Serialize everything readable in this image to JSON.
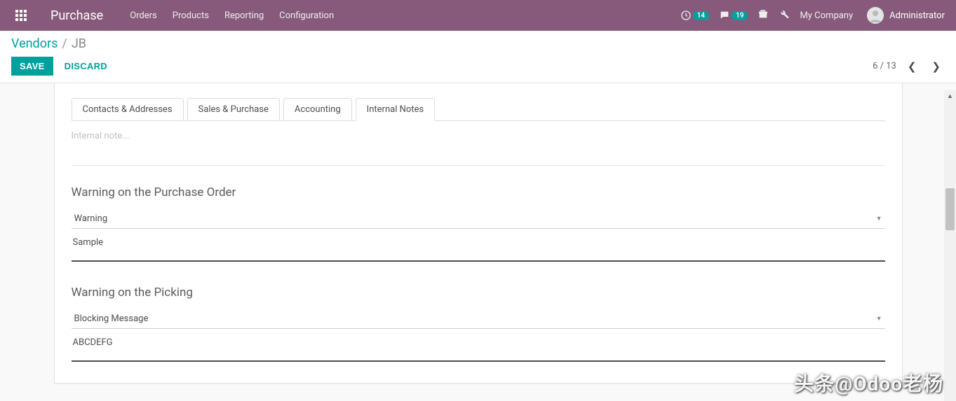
{
  "navbar": {
    "brand": "Purchase",
    "menu": [
      "Orders",
      "Products",
      "Reporting",
      "Configuration"
    ],
    "activity_count": "14",
    "message_count": "19",
    "company": "My Company",
    "user": "Administrator"
  },
  "breadcrumb": {
    "parent": "Vendors",
    "current": "JB"
  },
  "buttons": {
    "save": "SAVE",
    "discard": "DISCARD"
  },
  "pager": {
    "position": "6 / 13"
  },
  "tabs": [
    "Contacts & Addresses",
    "Sales & Purchase",
    "Accounting",
    "Internal Notes"
  ],
  "active_tab_index": 3,
  "internal_note_placeholder": "Internal note...",
  "sections": {
    "purchase_warn": {
      "title": "Warning on the Purchase Order",
      "select_value": "Warning",
      "text_value": "Sample"
    },
    "picking_warn": {
      "title": "Warning on the Picking",
      "select_value": "Blocking Message",
      "text_value": "ABCDEFG"
    }
  },
  "watermark": "头条@Odoo老杨"
}
